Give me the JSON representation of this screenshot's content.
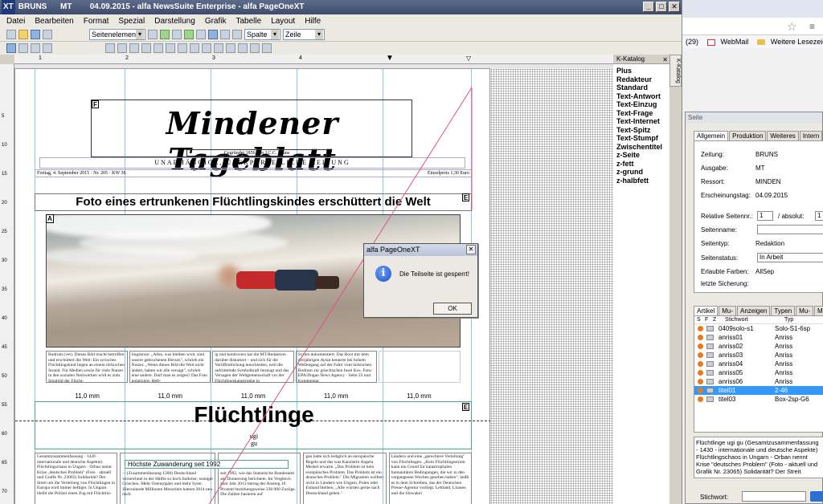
{
  "app": {
    "title_user": "BRUNS",
    "title_edition": "MT",
    "title_date": "04.09.2015",
    "title_app1": "alfa NewsSuite Enterprise",
    "title_app2": "alfa PageOneXT",
    "xt": "XT"
  },
  "menu": [
    "Datei",
    "Bearbeiten",
    "Format",
    "Spezial",
    "Darstellung",
    "Grafik",
    "Tabelle",
    "Layout",
    "Hilfe"
  ],
  "toolbar": {
    "element_select": "Seitenelement",
    "column_select": "Spalte",
    "row_select": "Zeile"
  },
  "ruler": {
    "h": [
      "1",
      "2",
      "3",
      "4"
    ],
    "v": [
      "5",
      "10",
      "15",
      "20",
      "25",
      "30",
      "35",
      "40",
      "45",
      "50",
      "55",
      "60",
      "65",
      "70"
    ]
  },
  "page": {
    "masthead_title": "Mindener Tageblatt",
    "founded": "Gegründet 1856 von J.C.C. Bruns",
    "tagline": "UNABHÄNGIGE, ÜBERPARTEILICHE ZEITUNG",
    "date_left": "Freitag, 4. September 2015 · Nr. 205 · KW 36",
    "date_right": "Einzelpreis 1,30 Euro",
    "headline": "Foto eines ertrunkenen Flüchtlingskindes erschüttert die Welt",
    "box_f": "F",
    "box_a": "A",
    "box_e": "E",
    "col_texts": [
      "Bodrum (vet). Dieses Bild macht betroffen und erschüttert die Welt: Ein syrisches Flüchtlingskind liegen an einem türkischen Strand. Für Medien sowie für viele Nutzer in den sozialen Netzwerken wird es zum Sinnbild der Flücht-",
      "lingskrise: „Alles, was bleiben wird, sind unsere gebrochenen Herzen\", schrieb ein Nutzer. „Wenn dieses Bild die Welt nicht ändert, haben wir alle versagt\", schrieb eine andere. Darf man es zeigen? Das Foto polarisiert. Heft-",
      "ig und kontrovers hat die MT-Redaktion darüber diskutiert – und sich für die Veröffentlichung entschieden, weil die aufrüttelnde Symbolkraft bezeugt und das Versagen der Weltgemeinschaft vor der Flüchtlingskatastrophe in",
      "Syrien dokumentiert. Das Boot mit dem dreijährigen Aylan kenterte bei hohem Wellengang auf der Fahrt vom türkischen Bodrum zur griechischen Insel Kos. Foto: EPA/Dogan News Agency · Seite 23 und Kommentar"
    ],
    "gaps": [
      "11,0 mm",
      "11,0 mm",
      "11,0 mm",
      "11,0 mm",
      "11,0 mm"
    ],
    "section_title": "Flüchtlinge",
    "section_sub1": "ugi",
    "section_sub2": "gu",
    "subhead": "Höchste Zuwanderung seit 1992",
    "lower_cols": [
      "Gesamtzusammenfassung · 1430 · internationale und deutsche Aspekte) Flüchtlingschaos in Ungarn · Orban nennt Krise „deutsches Problem\" (Foto · aktuell und Grafik Nr. 23065) Solidarität? Der Streit um die Verteilung von Flüchtlingen in Europa wird immer heftiger. In Ungarn bleibt die Polizei einen Zug mit Flüchtlin-",
      "—(Zusammenfassung 1200) Deutschland verzeichnet in der Hälfte so hoch Italiener, weniger Griechen. Mehr Osteuropäer und mehr Syrer. Hierzulande Millionen Menschen kamen 2014 neu nach",
      "seit 1992, wie das Statistische Bundesamt am Donnerstag berichtete. Im Vergleich zum Jahr 2013 betrug der Anstieg 19 Prozent beziehungsweise 238 000 Zuzüge. Die Zahlen basieren auf",
      "gan hatte sich lediglich an europäische Regeln und das was Kanzlerin Angela Merkel erwarte. „Das Problem ist kein europäisches Problem. Das Problem ist ein deutsches Problem.\" Die Migranten wollten nicht in Ländern wie Ungarn, Polen oder Estland bleiben. „Alle würden gerne nach Deutschland gehen.\"",
      "Ländern und eine „gerechtere Verteilung\" von Flüchtlingen. „Kein Flüchtlingsstrom kann ein Grund für katastrophalen humanitären Bedingungen, die wir in den vergangenen Wochen gesehen haben\", heißt es in dem Schreiben, das der Deutschen Presse-Agentur vorliegt. Lettland, Litauen und die Slowakei"
    ]
  },
  "dialog": {
    "title": "alfa PageOneXT",
    "message": "Die Teilseite ist gesperrt!",
    "ok": "OK"
  },
  "kkatalog": {
    "title": "K-Katalog",
    "tab": "K-Katalog",
    "items": [
      "Plus",
      "Redakteur",
      "Standard",
      "Text-Antwort",
      "Text-Einzug",
      "Text-Frage",
      "Text-Internet",
      "Text-Spitz",
      "Text-Stumpf",
      "Zwischentitel",
      "z-Seite",
      "z-fett",
      "z-grund",
      "z-halbfett"
    ]
  },
  "browser": {
    "bm_count": "(29)",
    "bm_webmail": "WebMail",
    "bm_folder": "Weitere Lesezeichen"
  },
  "seite": {
    "title": "Seite",
    "tabs": [
      "Allgemein",
      "Produktion",
      "Weiteres",
      "Intern"
    ],
    "zeitung_label": "Zeitung:",
    "zeitung": "BRUNS",
    "ausgabe_label": "Ausgabe:",
    "ausgabe": "MT",
    "ressort_label": "Ressort:",
    "ressort": "MINDEN",
    "erscheinungstag_label": "Erscheinungstag:",
    "erscheinungstag": "04.09.2015",
    "rel_label": "Relative Seitennr.:",
    "rel": "1",
    "abs_label": "/ absolut:",
    "abs": "1",
    "seitenname_label": "Seitenname:",
    "seitentyp_label": "Seitentyp:",
    "seitentyp": "Redaktion",
    "seitenstatus_label": "Seitenstatus:",
    "seitenstatus": "In Arbeit",
    "farben_label": "Erlaubte Farben:",
    "farben": "AllSep",
    "sicherung_label": "letzte Sicherung:",
    "tabs2": [
      "Artikel",
      "Mu-Art",
      "Anzeigen",
      "Typen",
      "Mu-Seit",
      "M"
    ],
    "list_headers": [
      "S",
      "F",
      "Z",
      "Stichwort",
      "Typ"
    ],
    "rows": [
      {
        "name": "0409solo-s1",
        "type": "Solo-S1-6sp"
      },
      {
        "name": "anriss01",
        "type": "Anriss"
      },
      {
        "name": "anriss02",
        "type": "Anriss"
      },
      {
        "name": "anriss03",
        "type": "Anriss"
      },
      {
        "name": "anriss04",
        "type": "Anriss"
      },
      {
        "name": "anriss05",
        "type": "Anriss"
      },
      {
        "name": "anriss06",
        "type": "Anriss"
      },
      {
        "name": "titel01",
        "type": "2-46"
      },
      {
        "name": "titel03",
        "type": "Box-2sp-G6"
      }
    ],
    "selected_index": 7,
    "notes": "Flüchtlinge ugi gu (Gesamtzusammenfassung - 1430 - internationale und deutsche Aspekte) Flüchtlingschaos in Ungarn - Orban nennt Krise \"deutsches Problem\" (Foto - aktuell und Grafik Nr. 23065) Solidarität? Der Streit",
    "stichwort_label": "Stichwort:"
  }
}
